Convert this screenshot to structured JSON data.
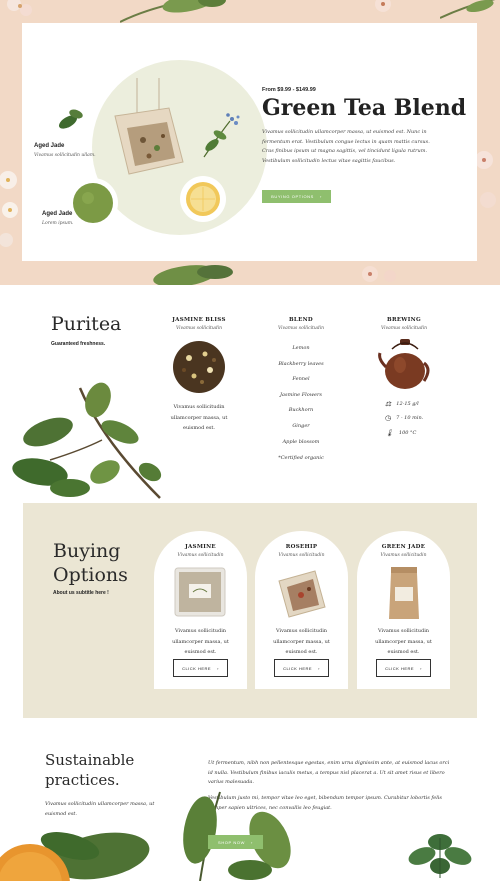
{
  "hero": {
    "price": "From $9.99 - $149.99",
    "title": "Green Tea Blend",
    "description": "Vivamus sollicitudin ullamcorper massa, ut euismod est. Nunc in fermentum erat. Vestibulum congue lectus in quam mattis cursus. Cras finibus ipsum ut magna sagittis, vel tincidunt ligula rutrum. Vestibulum sollicitudin lectus vitae sagittis faucibus.",
    "button_label": "BUYING OPTIONS",
    "button_arrow": "›",
    "label_1": "Aged Jade",
    "sub_1": "Vivamus sollicitudin ullam.",
    "label_2": "Aged Jade",
    "sub_2": "Lorem ipsum."
  },
  "puritea": {
    "brand": "Puritea",
    "tagline": "Guaranteed freshness.",
    "jasmine": {
      "title": "JASMINE BLISS",
      "subtitle": "Vivamus sollicitudin",
      "text": "Vivamus sollicitudin ullamcorper massa, ut euismod est."
    },
    "blend": {
      "title": "BLEND",
      "subtitle": "Vivamus sollicitudin",
      "items": [
        "Lemon",
        "Blackberry leaves",
        "Fennel",
        "Jasmine Flowers",
        "Buckhorn",
        "Ginger",
        "Apple blossom",
        "*Certified organic"
      ]
    },
    "brewing": {
      "title": "BREWING",
      "subtitle": "Vivamus sollicitudin",
      "amount": "12-15 g/l",
      "time": "7 - 10 min.",
      "temp": "100 °C"
    }
  },
  "buying": {
    "title_line1": "Buying",
    "title_line2": "Options",
    "subtitle": "About us subtitle here !",
    "cards": [
      {
        "title": "JASMINE",
        "subtitle": "Vivamus sollicitudin",
        "text": "Vivamus sollicitudin ullamcorper massa, ut euismod est.",
        "button": "CLICK HERE",
        "arrow": "›"
      },
      {
        "title": "ROSEHIP",
        "subtitle": "Vivamus sollicitudin",
        "text": "Vivamus sollicitudin ullamcorper massa, ut euismod est.",
        "button": "CLICK HERE",
        "arrow": "›"
      },
      {
        "title": "GREEN JADE",
        "subtitle": "Vivamus sollicitudin",
        "text": "Vivamus sollicitudin ullamcorper massa, ut euismod est.",
        "button": "CLICK HERE",
        "arrow": "›"
      }
    ]
  },
  "sustainable": {
    "title_line1": "Sustainable",
    "title_line2": "practices.",
    "left_text": "Vivamus sollicitudin ullamcorper massa, ut euismod est.",
    "para1": "Ut fermentum, nibh non pellentesque egestas, enim urna dignissim ante, at euismod lacus orci id nulla. Vestibulum finibus iaculis metus, a tempus nisl placerat a. Ut sit amet risus et libero varius malesuada.",
    "para2": "Vestibulum justo mi, tempor vitae leo eget, bibendum tempor ipsum. Curabitur lobortis felis semper sapien ultrices, nec convallis leo feugiat.",
    "button_label": "SHOP NOW",
    "button_arrow": "›"
  },
  "colors": {
    "hero_bg": "#f2d9c6",
    "accent_green": "#8fbf6e",
    "buying_bg": "#ebe6d4"
  }
}
